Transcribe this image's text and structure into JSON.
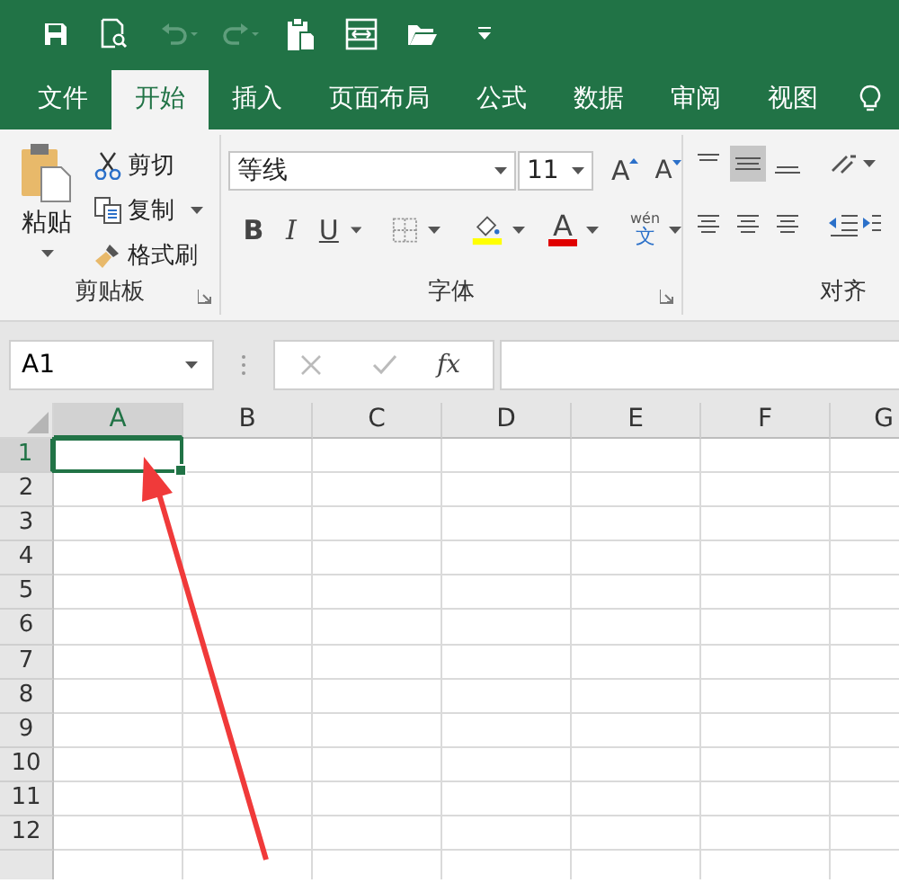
{
  "tabs": [
    {
      "label": "文件",
      "selected": false
    },
    {
      "label": "开始",
      "selected": true
    },
    {
      "label": "插入",
      "selected": false
    },
    {
      "label": "页面布局",
      "selected": false
    },
    {
      "label": "公式",
      "selected": false
    },
    {
      "label": "数据",
      "selected": false
    },
    {
      "label": "审阅",
      "selected": false
    },
    {
      "label": "视图",
      "selected": false
    }
  ],
  "clipboard": {
    "title": "剪贴板",
    "paste": "粘贴",
    "cut": "剪切",
    "copy": "复制",
    "format_painter": "格式刷"
  },
  "font": {
    "title": "字体",
    "font_name": "等线",
    "font_size": "11",
    "grow": "A",
    "shrink": "A",
    "bold": "B",
    "italic": "I",
    "underline": "U",
    "font_color": "A",
    "phonetic_top": "wén",
    "phonetic_bottom": "文"
  },
  "alignment": {
    "title": "对齐"
  },
  "name_box": {
    "value": "A1"
  },
  "formula_bar": {
    "function_label": "fx"
  },
  "sheet": {
    "columns": [
      {
        "label": "A",
        "selected": true
      },
      {
        "label": "B",
        "selected": false
      },
      {
        "label": "C",
        "selected": false
      },
      {
        "label": "D",
        "selected": false
      },
      {
        "label": "E",
        "selected": false
      },
      {
        "label": "F",
        "selected": false
      },
      {
        "label": "G",
        "selected": false
      }
    ],
    "rows": [
      {
        "label": "1",
        "selected": true
      },
      {
        "label": "2",
        "selected": false
      },
      {
        "label": "3",
        "selected": false
      },
      {
        "label": "4",
        "selected": false
      },
      {
        "label": "5",
        "selected": false
      },
      {
        "label": "6",
        "selected": false
      },
      {
        "label": "7",
        "selected": false
      },
      {
        "label": "8",
        "selected": false
      },
      {
        "label": "9",
        "selected": false
      },
      {
        "label": "10",
        "selected": false
      },
      {
        "label": "11",
        "selected": false
      },
      {
        "label": "12",
        "selected": false
      }
    ]
  }
}
